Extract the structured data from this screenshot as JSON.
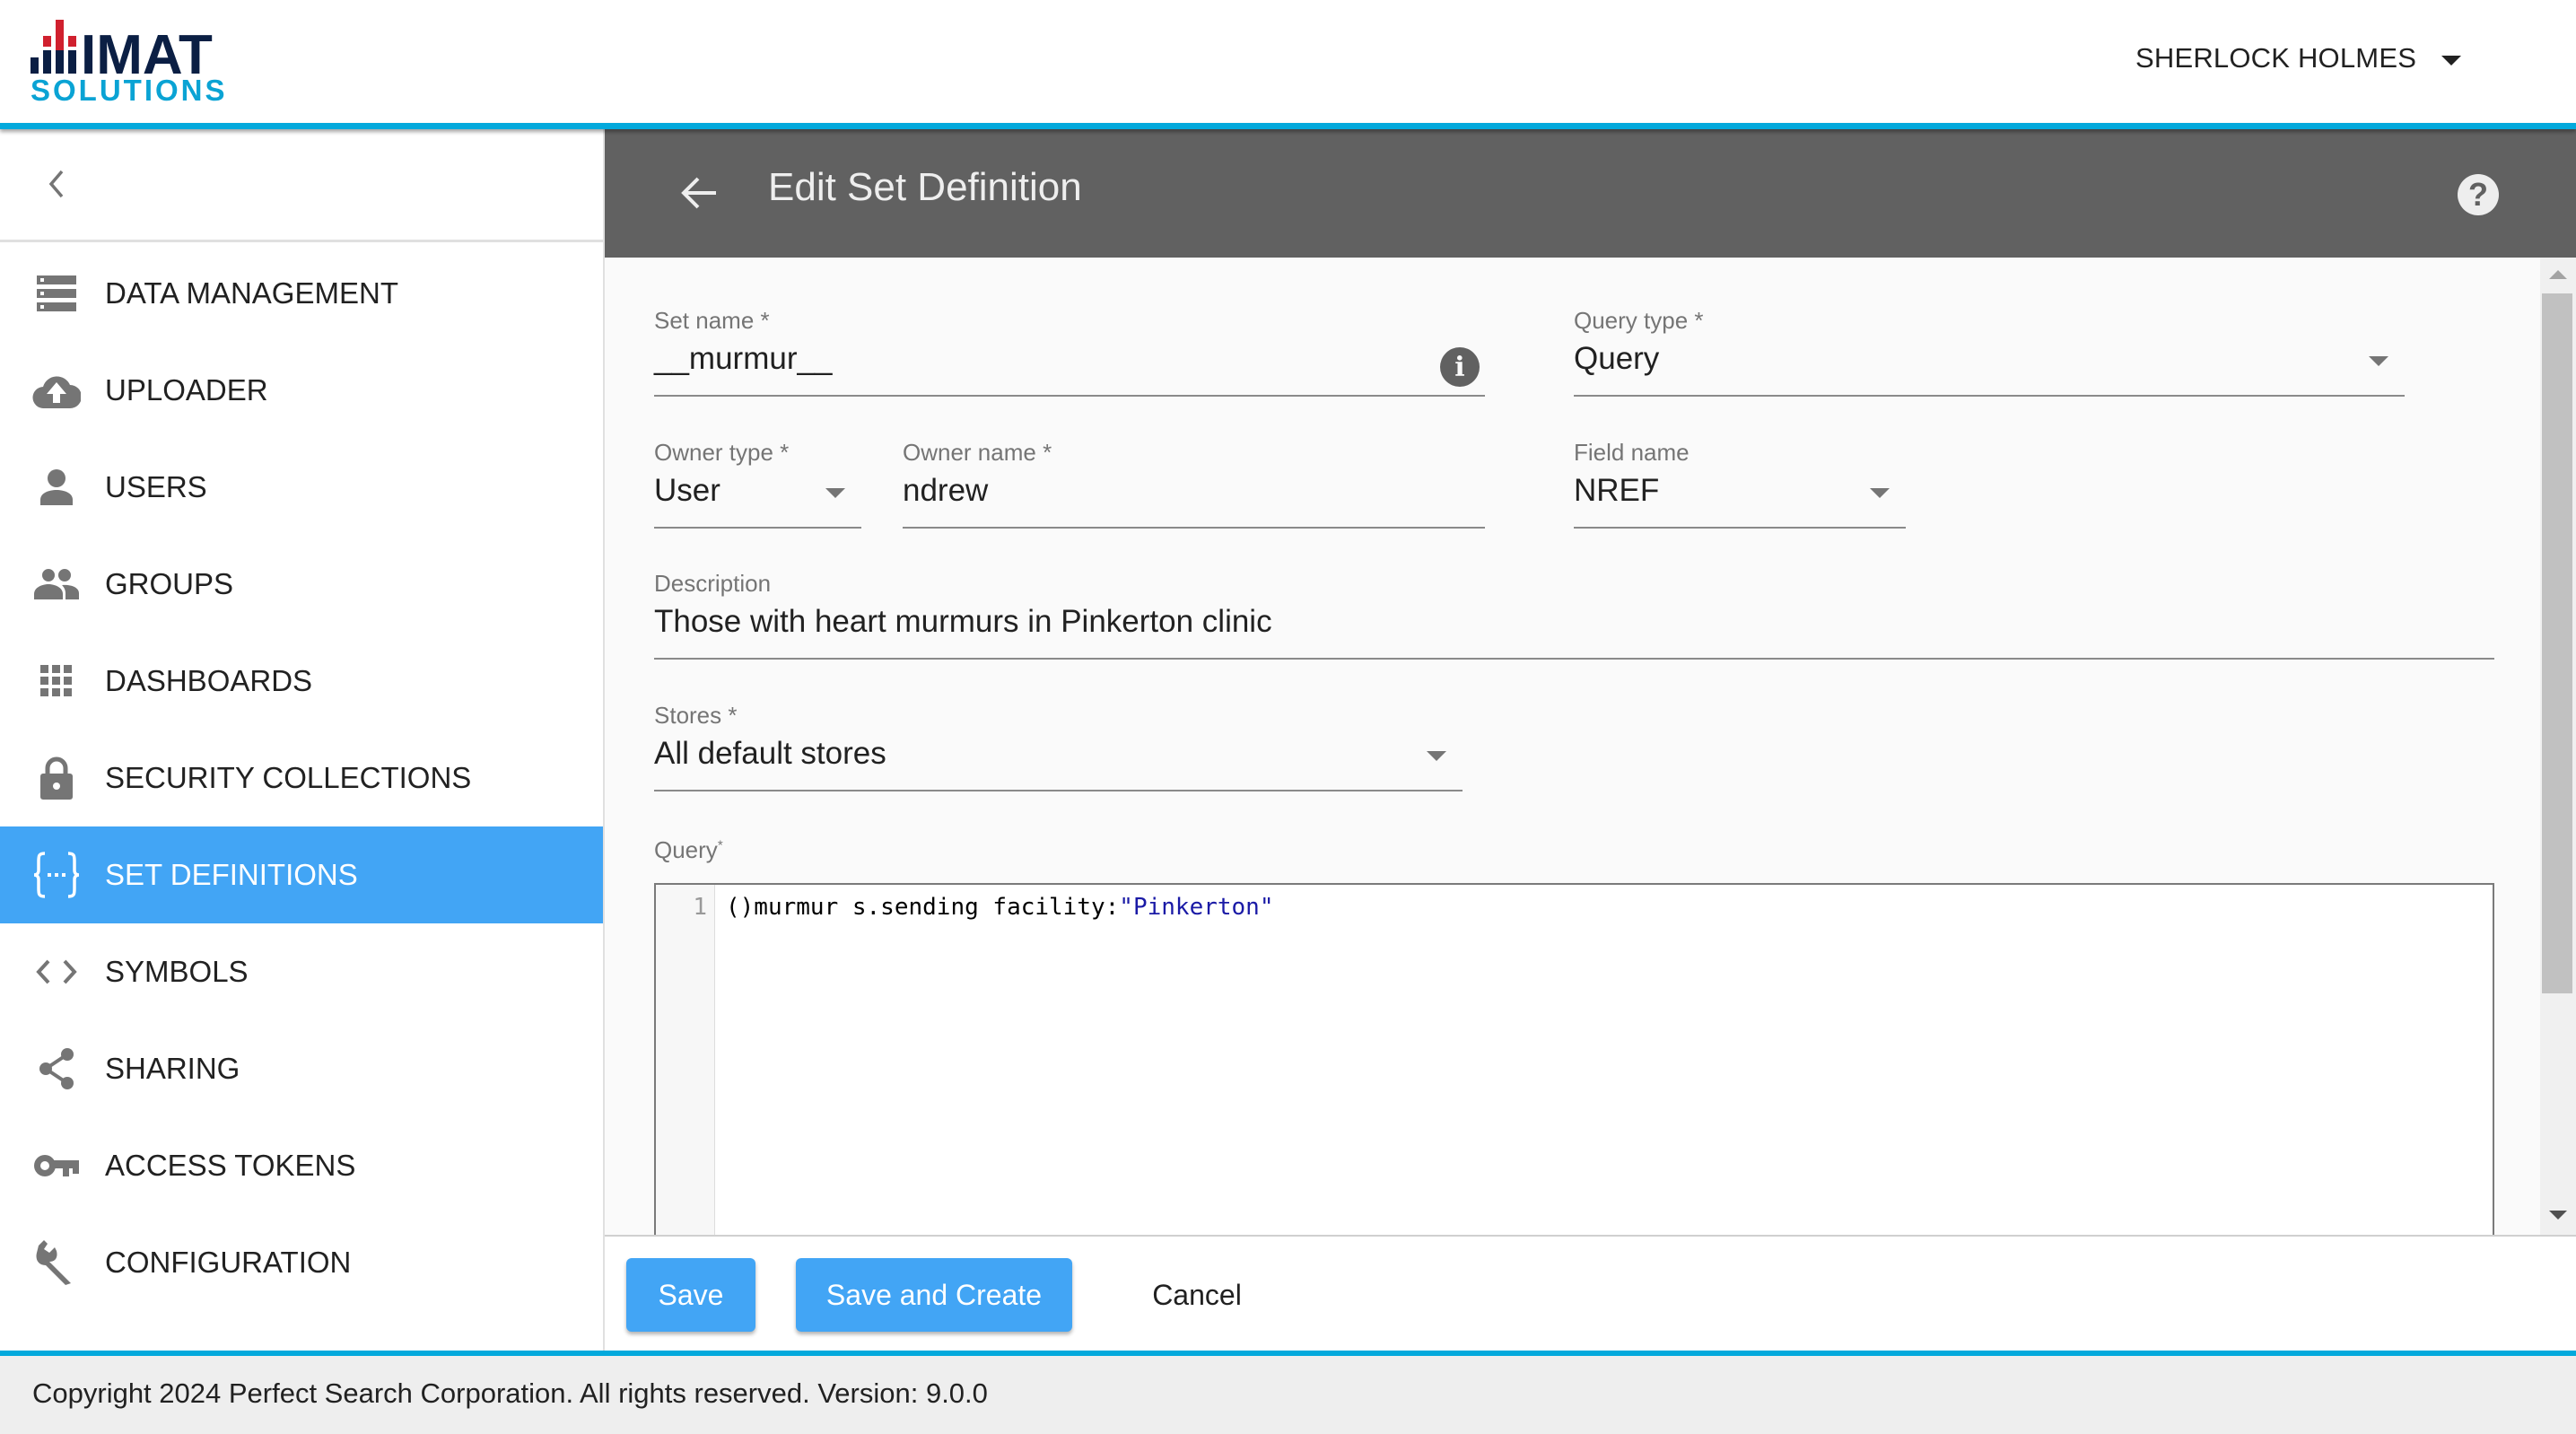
{
  "app": {
    "logo_top": "IMAT",
    "logo_bottom": "SOLUTIONS",
    "colors": {
      "brand_navy": "#0b1f44",
      "brand_red": "#d0202e",
      "brand_cyan": "#0aa3d4",
      "accent": "#42a5f5",
      "header_bar": "#616161",
      "top_border": "#03a9dc"
    }
  },
  "user_menu": {
    "name": "SHERLOCK HOLMES",
    "icon": "caret-down-icon"
  },
  "sidebar": {
    "collapse_icon": "chevron-left-icon",
    "items": [
      {
        "label": "DATA MANAGEMENT",
        "icon": "storage-icon",
        "active": false
      },
      {
        "label": "UPLOADER",
        "icon": "cloud-upload-icon",
        "active": false
      },
      {
        "label": "USERS",
        "icon": "person-icon",
        "active": false
      },
      {
        "label": "GROUPS",
        "icon": "people-icon",
        "active": false
      },
      {
        "label": "DASHBOARDS",
        "icon": "grid-icon",
        "active": false
      },
      {
        "label": "SECURITY COLLECTIONS",
        "icon": "lock-icon",
        "active": false
      },
      {
        "label": "SET DEFINITIONS",
        "icon": "braces-icon",
        "active": true
      },
      {
        "label": "SYMBOLS",
        "icon": "code-icon",
        "active": false
      },
      {
        "label": "SHARING",
        "icon": "share-icon",
        "active": false
      },
      {
        "label": "ACCESS TOKENS",
        "icon": "key-icon",
        "active": false
      },
      {
        "label": "CONFIGURATION",
        "icon": "wrench-icon",
        "active": false
      }
    ]
  },
  "page": {
    "title": "Edit Set Definition",
    "back_icon": "arrow-left-icon",
    "help_icon": "help-icon",
    "help_glyph": "?"
  },
  "form": {
    "set_name": {
      "label": "Set name *",
      "value": "__murmur__",
      "info_glyph": "i"
    },
    "query_type": {
      "label": "Query type *",
      "value": "Query"
    },
    "owner_type": {
      "label": "Owner type *",
      "value": "User"
    },
    "owner_name": {
      "label": "Owner name *",
      "value": "ndrew"
    },
    "field_name": {
      "label": "Field name",
      "value": "NREF"
    },
    "description": {
      "label": "Description",
      "value": "Those with heart murmurs in Pinkerton clinic"
    },
    "stores": {
      "label": "Stores *",
      "value": "All default stores"
    },
    "query": {
      "label": "Query",
      "required_mark": "*",
      "line_number": "1",
      "code_plain": "()murmur s.sending facility:",
      "code_string": "\"Pinkerton\""
    }
  },
  "actions": {
    "save": "Save",
    "save_and_create": "Save and Create",
    "cancel": "Cancel"
  },
  "footer": {
    "text": "Copyright 2024 Perfect Search Corporation. All rights reserved. Version: 9.0.0"
  }
}
